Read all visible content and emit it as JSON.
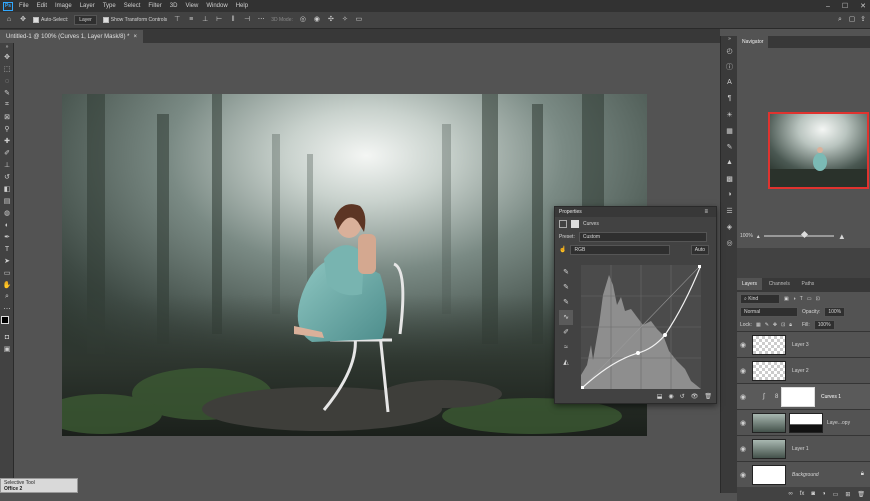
{
  "app": {
    "logo": "Ps",
    "menu": [
      "File",
      "Edit",
      "Image",
      "Layer",
      "Type",
      "Select",
      "Filter",
      "3D",
      "View",
      "Window",
      "Help"
    ],
    "window_controls": [
      "–",
      "☐",
      "✕"
    ]
  },
  "options_bar": {
    "auto_select_label": "Auto-Select:",
    "auto_select_value": "Layer",
    "transform_label": "Show Transform Controls",
    "mode_3d": "3D Mode:"
  },
  "document": {
    "tab_title": "Untitled-1 @ 100% (Curves 1, Layer Mask/8) *",
    "close": "×"
  },
  "navigator": {
    "tab": "Navigator",
    "zoom": "100%"
  },
  "properties": {
    "title": "Properties",
    "adjustment": "Curves",
    "preset_label": "Preset:",
    "preset_value": "Custom",
    "channel_value": "RGB",
    "auto_label": "Auto"
  },
  "layers_panel": {
    "tabs": [
      "Layers",
      "Channels",
      "Paths"
    ],
    "filter_value": "Kind",
    "blend_mode": "Normal",
    "opacity_label": "Opacity:",
    "opacity_value": "100%",
    "lock_label": "Lock:",
    "fill_label": "Fill:",
    "fill_value": "100%",
    "layers": [
      {
        "name": "Layer 3"
      },
      {
        "name": "Layer 2"
      },
      {
        "name": "Curves 1"
      },
      {
        "name": "Laye...opy"
      },
      {
        "name": "Layer 1"
      },
      {
        "name": "Background"
      }
    ]
  },
  "mini_hud": {
    "title": "Selective Tool",
    "value": "Office 2"
  }
}
